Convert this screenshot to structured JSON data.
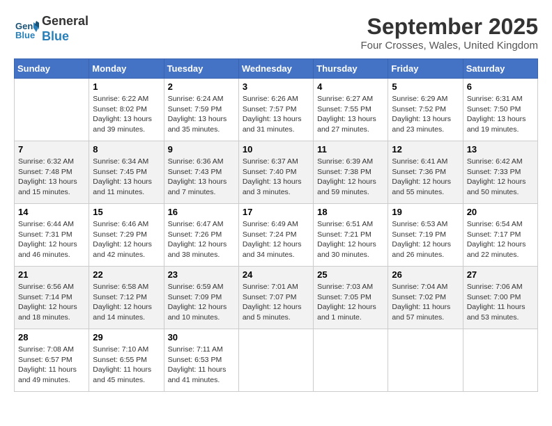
{
  "header": {
    "logo_line1": "General",
    "logo_line2": "Blue",
    "month": "September 2025",
    "location": "Four Crosses, Wales, United Kingdom"
  },
  "days_of_week": [
    "Sunday",
    "Monday",
    "Tuesday",
    "Wednesday",
    "Thursday",
    "Friday",
    "Saturday"
  ],
  "weeks": [
    [
      {
        "day": "",
        "info": ""
      },
      {
        "day": "1",
        "info": "Sunrise: 6:22 AM\nSunset: 8:02 PM\nDaylight: 13 hours\nand 39 minutes."
      },
      {
        "day": "2",
        "info": "Sunrise: 6:24 AM\nSunset: 7:59 PM\nDaylight: 13 hours\nand 35 minutes."
      },
      {
        "day": "3",
        "info": "Sunrise: 6:26 AM\nSunset: 7:57 PM\nDaylight: 13 hours\nand 31 minutes."
      },
      {
        "day": "4",
        "info": "Sunrise: 6:27 AM\nSunset: 7:55 PM\nDaylight: 13 hours\nand 27 minutes."
      },
      {
        "day": "5",
        "info": "Sunrise: 6:29 AM\nSunset: 7:52 PM\nDaylight: 13 hours\nand 23 minutes."
      },
      {
        "day": "6",
        "info": "Sunrise: 6:31 AM\nSunset: 7:50 PM\nDaylight: 13 hours\nand 19 minutes."
      }
    ],
    [
      {
        "day": "7",
        "info": "Sunrise: 6:32 AM\nSunset: 7:48 PM\nDaylight: 13 hours\nand 15 minutes."
      },
      {
        "day": "8",
        "info": "Sunrise: 6:34 AM\nSunset: 7:45 PM\nDaylight: 13 hours\nand 11 minutes."
      },
      {
        "day": "9",
        "info": "Sunrise: 6:36 AM\nSunset: 7:43 PM\nDaylight: 13 hours\nand 7 minutes."
      },
      {
        "day": "10",
        "info": "Sunrise: 6:37 AM\nSunset: 7:40 PM\nDaylight: 13 hours\nand 3 minutes."
      },
      {
        "day": "11",
        "info": "Sunrise: 6:39 AM\nSunset: 7:38 PM\nDaylight: 12 hours\nand 59 minutes."
      },
      {
        "day": "12",
        "info": "Sunrise: 6:41 AM\nSunset: 7:36 PM\nDaylight: 12 hours\nand 55 minutes."
      },
      {
        "day": "13",
        "info": "Sunrise: 6:42 AM\nSunset: 7:33 PM\nDaylight: 12 hours\nand 50 minutes."
      }
    ],
    [
      {
        "day": "14",
        "info": "Sunrise: 6:44 AM\nSunset: 7:31 PM\nDaylight: 12 hours\nand 46 minutes."
      },
      {
        "day": "15",
        "info": "Sunrise: 6:46 AM\nSunset: 7:29 PM\nDaylight: 12 hours\nand 42 minutes."
      },
      {
        "day": "16",
        "info": "Sunrise: 6:47 AM\nSunset: 7:26 PM\nDaylight: 12 hours\nand 38 minutes."
      },
      {
        "day": "17",
        "info": "Sunrise: 6:49 AM\nSunset: 7:24 PM\nDaylight: 12 hours\nand 34 minutes."
      },
      {
        "day": "18",
        "info": "Sunrise: 6:51 AM\nSunset: 7:21 PM\nDaylight: 12 hours\nand 30 minutes."
      },
      {
        "day": "19",
        "info": "Sunrise: 6:53 AM\nSunset: 7:19 PM\nDaylight: 12 hours\nand 26 minutes."
      },
      {
        "day": "20",
        "info": "Sunrise: 6:54 AM\nSunset: 7:17 PM\nDaylight: 12 hours\nand 22 minutes."
      }
    ],
    [
      {
        "day": "21",
        "info": "Sunrise: 6:56 AM\nSunset: 7:14 PM\nDaylight: 12 hours\nand 18 minutes."
      },
      {
        "day": "22",
        "info": "Sunrise: 6:58 AM\nSunset: 7:12 PM\nDaylight: 12 hours\nand 14 minutes."
      },
      {
        "day": "23",
        "info": "Sunrise: 6:59 AM\nSunset: 7:09 PM\nDaylight: 12 hours\nand 10 minutes."
      },
      {
        "day": "24",
        "info": "Sunrise: 7:01 AM\nSunset: 7:07 PM\nDaylight: 12 hours\nand 5 minutes."
      },
      {
        "day": "25",
        "info": "Sunrise: 7:03 AM\nSunset: 7:05 PM\nDaylight: 12 hours\nand 1 minute."
      },
      {
        "day": "26",
        "info": "Sunrise: 7:04 AM\nSunset: 7:02 PM\nDaylight: 11 hours\nand 57 minutes."
      },
      {
        "day": "27",
        "info": "Sunrise: 7:06 AM\nSunset: 7:00 PM\nDaylight: 11 hours\nand 53 minutes."
      }
    ],
    [
      {
        "day": "28",
        "info": "Sunrise: 7:08 AM\nSunset: 6:57 PM\nDaylight: 11 hours\nand 49 minutes."
      },
      {
        "day": "29",
        "info": "Sunrise: 7:10 AM\nSunset: 6:55 PM\nDaylight: 11 hours\nand 45 minutes."
      },
      {
        "day": "30",
        "info": "Sunrise: 7:11 AM\nSunset: 6:53 PM\nDaylight: 11 hours\nand 41 minutes."
      },
      {
        "day": "",
        "info": ""
      },
      {
        "day": "",
        "info": ""
      },
      {
        "day": "",
        "info": ""
      },
      {
        "day": "",
        "info": ""
      }
    ]
  ]
}
